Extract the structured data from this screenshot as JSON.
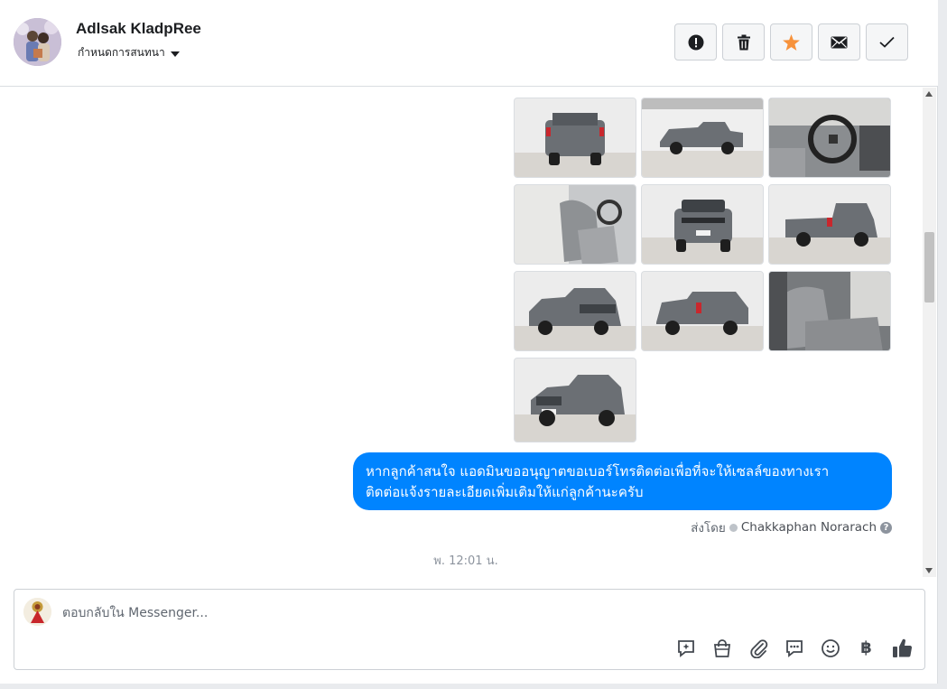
{
  "header": {
    "contact_name": "Adlsak KladpRee",
    "assign_label": "กำหนดการสนทนา"
  },
  "actions": [
    {
      "name": "report-button",
      "icon": "exclamation-circle-icon"
    },
    {
      "name": "delete-button",
      "icon": "trash-icon"
    },
    {
      "name": "star-button",
      "icon": "star-icon"
    },
    {
      "name": "mark-unread-button",
      "icon": "envelope-icon"
    },
    {
      "name": "mark-done-button",
      "icon": "checkmark-icon"
    }
  ],
  "chat": {
    "message_text_line1": "หากลูกค้าสนใจ แอดมินขออนุญาตขอเบอร์โทรติดต่อเพื่อที่จะให้เซลล์ของทางเรา",
    "message_text_line2": "ติดต่อแจ้งรายละเอียดเพิ่มเติมให้แก่ลูกค้านะครับ",
    "sent_by_label": "ส่งโดย",
    "sender_name": "Chakkaphan Norarach",
    "timestamp": "พ. 12:01 น.",
    "photo_count": 10
  },
  "composer": {
    "placeholder": "ตอบกลับใน Messenger...",
    "baht_symbol": "฿"
  },
  "colors": {
    "bubble": "#0084ff",
    "star": "#f7923b",
    "truck": "#6b6f74"
  }
}
